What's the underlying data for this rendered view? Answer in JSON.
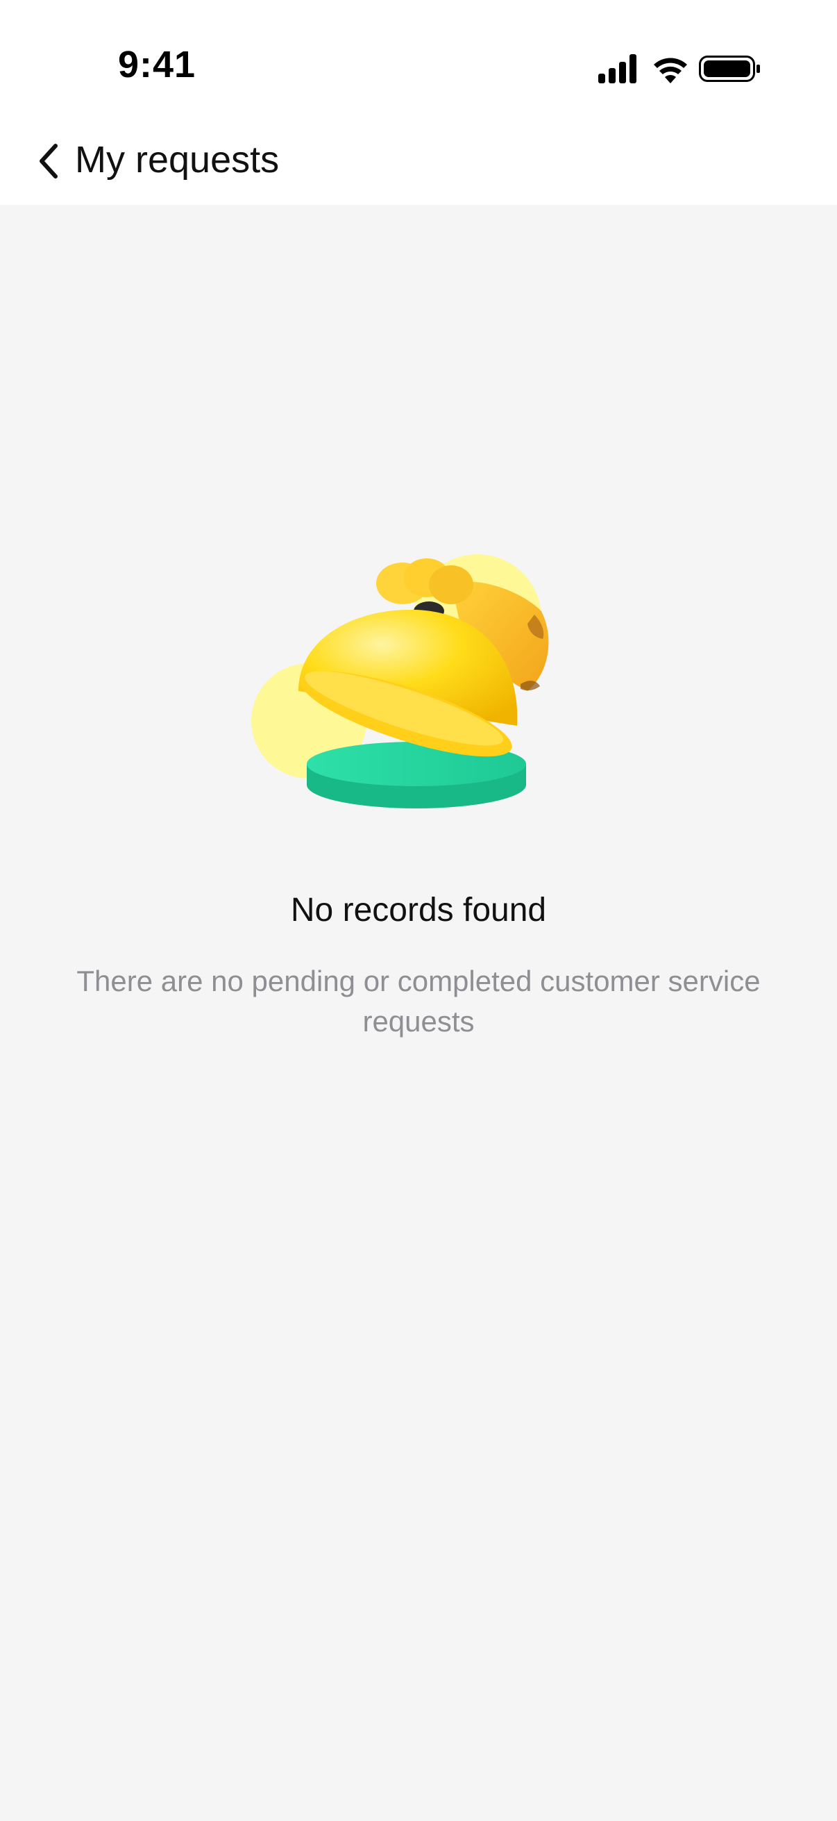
{
  "status_bar": {
    "time": "9:41"
  },
  "nav": {
    "title": "My requests"
  },
  "empty_state": {
    "title": "No records found",
    "description": "There are no pending or completed customer service requests"
  },
  "colors": {
    "background": "#f5f5f6",
    "header": "#ffffff",
    "title_text": "#111111",
    "description_text": "#8e8e93",
    "bell_yellow": "#ffd400",
    "base_green": "#1ec994"
  },
  "icons": {
    "back": "chevron-left-icon",
    "signal": "cellular-signal-icon",
    "wifi": "wifi-icon",
    "battery": "battery-icon",
    "illustration": "service-bell-illustration"
  }
}
